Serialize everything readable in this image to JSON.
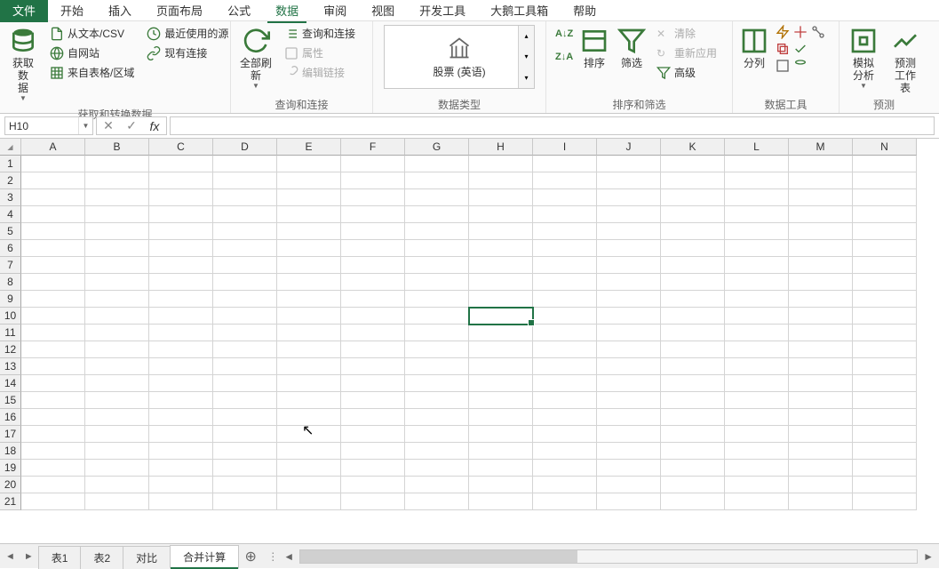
{
  "tabs": {
    "file": "文件",
    "home": "开始",
    "insert": "插入",
    "pageLayout": "页面布局",
    "formulas": "公式",
    "data": "数据",
    "review": "审阅",
    "view": "视图",
    "developer": "开发工具",
    "addin": "大鹅工具箱",
    "help": "帮助",
    "active": "data"
  },
  "ribbon": {
    "group1": {
      "label": "获取和转换数据",
      "getData": "获取数\n据",
      "fromText": "从文本/CSV",
      "fromWeb": "自网站",
      "fromTable": "来自表格/区域",
      "recent": "最近使用的源",
      "existing": "现有连接"
    },
    "group2": {
      "label": "查询和连接",
      "refreshAll": "全部刷新",
      "queries": "查询和连接",
      "properties": "属性",
      "editLinks": "编辑链接"
    },
    "group3": {
      "label": "数据类型",
      "stocks": "股票 (英语)"
    },
    "group4": {
      "label": "排序和筛选",
      "sort": "排序",
      "filter": "筛选",
      "clear": "清除",
      "reapply": "重新应用",
      "advanced": "高级"
    },
    "group5": {
      "label": "数据工具",
      "textToColumns": "分列"
    },
    "group6": {
      "label": "预测",
      "whatIf": "模拟分析",
      "forecast": "预测\n工作表"
    }
  },
  "namebox": {
    "value": "H10"
  },
  "columns": [
    "A",
    "B",
    "C",
    "D",
    "E",
    "F",
    "G",
    "H",
    "I",
    "J",
    "K",
    "L",
    "M",
    "N"
  ],
  "rows": [
    1,
    2,
    3,
    4,
    5,
    6,
    7,
    8,
    9,
    10,
    11,
    12,
    13,
    14,
    15,
    16,
    17,
    18,
    19,
    20,
    21
  ],
  "selectedCell": {
    "col": "H",
    "row": 10
  },
  "sheets": {
    "items": [
      {
        "name": "表1",
        "active": false
      },
      {
        "name": "表2",
        "active": false
      },
      {
        "name": "对比",
        "active": false
      },
      {
        "name": "合并计算",
        "active": true
      }
    ]
  }
}
